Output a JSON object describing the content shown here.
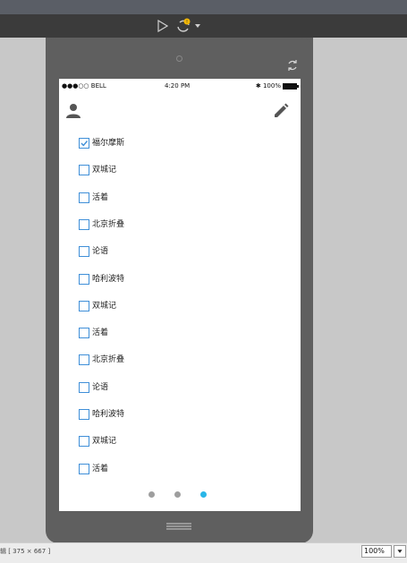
{
  "toolbar": {
    "play_icon": "play-icon",
    "sync_icon": "sync-icon",
    "warning_badge": "!"
  },
  "status_bar": {
    "carrier": "●●●○○ BELL",
    "time": "4:20 PM",
    "battery": "✱ 100%"
  },
  "header": {
    "left_icon": "user-icon",
    "right_icon": "edit-icon"
  },
  "list": {
    "items": [
      {
        "label": "福尔摩斯",
        "checked": true
      },
      {
        "label": "双城记",
        "checked": false
      },
      {
        "label": "活着",
        "checked": false
      },
      {
        "label": "北京折叠",
        "checked": false
      },
      {
        "label": "论语",
        "checked": false
      },
      {
        "label": "哈利波特",
        "checked": false
      },
      {
        "label": "双城记",
        "checked": false
      },
      {
        "label": "活着",
        "checked": false
      },
      {
        "label": "北京折叠",
        "checked": false
      },
      {
        "label": "论语",
        "checked": false
      },
      {
        "label": "哈利波特",
        "checked": false
      },
      {
        "label": "双城记",
        "checked": false
      },
      {
        "label": "活着",
        "checked": false
      }
    ]
  },
  "pager": {
    "count": 3,
    "active": 2
  },
  "bottom": {
    "size_label": "辑 [ 375 × 667 ]",
    "zoom": "100%"
  },
  "colors": {
    "accent": "#29b6e8",
    "checkbox": "#3f8fd8",
    "device": "#5f5f5f"
  }
}
